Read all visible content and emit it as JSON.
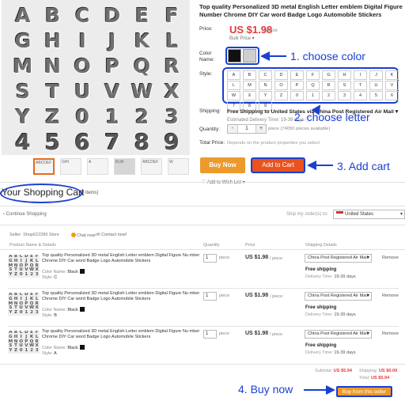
{
  "product": {
    "hero_rows": [
      [
        "A",
        "B",
        "C",
        "D",
        "E",
        "F"
      ],
      [
        "G",
        "H",
        "I",
        "J",
        "K",
        "L"
      ],
      [
        "M",
        "N",
        "O",
        "P",
        "Q",
        "R"
      ],
      [
        "S",
        "T",
        "U",
        "V",
        "W",
        "X"
      ],
      [
        "Y",
        "Z",
        "0",
        "1",
        "2",
        "3"
      ],
      [
        "4",
        "5",
        "6",
        "7",
        "8",
        "9"
      ]
    ],
    "thumbnails": [
      "ABCDEF",
      "GHI",
      "A",
      "KLM",
      "ABCDEF",
      "W"
    ],
    "title": "Top quality Personalized 3D metal English Letter emblem Digital Figure Number Chrome DIY Car word Badge Logo Automobile Stickers",
    "price_label": "Price:",
    "price": "US $1.98",
    "price_unit": "/ piece",
    "bulk_price": "Bulk Price ▾",
    "color_label": "Color Name:",
    "colors": [
      "#111111",
      "#cfcfcf"
    ],
    "style_label": "Style:",
    "styles": [
      "A",
      "B",
      "C",
      "D",
      "E",
      "F",
      "G",
      "H",
      "I",
      "J",
      "K",
      "L",
      "M",
      "N",
      "O",
      "P",
      "Q",
      "R",
      "S",
      "T",
      "U",
      "V",
      "W",
      "X",
      "Y",
      "Z",
      "0",
      "1",
      "2",
      "3",
      "4",
      "5",
      "6",
      "7",
      "8",
      "9"
    ],
    "shipping_label": "Shipping:",
    "shipping_text": "Free Shipping to United States via China Post Registered Air Mail ▾",
    "shipping_estimate": "Estimated Delivery Time: 19-39 days ⓘ",
    "quantity_label": "Quantity:",
    "quantity_value": "1",
    "quantity_minus": "-",
    "quantity_plus": "+",
    "quantity_note": "piece (74050 pieces available)",
    "total_price_label": "Total Price:",
    "total_price_text": "Depends on the product properties you select",
    "buy_now": "Buy Now",
    "add_to_cart": "Add to Cart",
    "wish": "Add to Wish List ▾",
    "wish_icon": "heart-icon"
  },
  "annotations": {
    "step1": "1. choose color",
    "step2": "2. choose letter",
    "step3": "3. Add cart",
    "step4": "4. Buy now"
  },
  "cart": {
    "title": "Your Shopping Cart",
    "count": "(3 items)",
    "continue": "‹ Continue Shopping",
    "ship_to_label": "Ship my order(s) to:",
    "country": "United States",
    "seller": "Seller:  Shop622289 Store",
    "chat": "Chat now!",
    "contact": "Contact now!",
    "headers": {
      "product": "Product Name & Details",
      "quantity": "Quantity",
      "price": "Price",
      "shipping": "Shipping Details"
    },
    "items": [
      {
        "title": "Top quality Personalized 3D metal English Letter emblem Digital Figure Nu mber Chrome DIY Car word Badge Logo Automobile Stickers",
        "color_label": "Color Name:",
        "color": "Black",
        "style_label": "Style:",
        "style": "C",
        "qty": "1",
        "unit": "piece",
        "price": "US $1.98",
        "per": "/ piece",
        "shipping_method": "China Post Registered Air Mail",
        "free_shipping": "Free shipping",
        "delivery_label": "Delivery Time:",
        "delivery": "19-39 days",
        "remove": "Remove"
      },
      {
        "title": "Top quality Personalized 3D metal English Letter emblem Digital Figure Nu mber Chrome DIY Car word Badge Logo Automobile Stickers",
        "color_label": "Color Name:",
        "color": "Black",
        "style_label": "Style:",
        "style": "B",
        "qty": "1",
        "unit": "piece",
        "price": "US $1.98",
        "per": "/ piece",
        "shipping_method": "China Post Registered Air Mail",
        "free_shipping": "Free shipping",
        "delivery_label": "Delivery Time:",
        "delivery": "19-39 days",
        "remove": "Remove"
      },
      {
        "title": "Top quality Personalized 3D metal English Letter emblem Digital Figure Nu mber Chrome DIY Car word Badge Logo Automobile Stickers",
        "color_label": "Color Name:",
        "color": "Black",
        "style_label": "Style:",
        "style": "A",
        "qty": "1",
        "unit": "piece",
        "price": "US $1.98",
        "per": "/ piece",
        "shipping_method": "China Post Registered Air Mail",
        "free_shipping": "Free shipping",
        "delivery_label": "Delivery Time:",
        "delivery": "19-39 days",
        "remove": "Remove"
      }
    ],
    "subtotal_label": "Subtotal:",
    "subtotal": "US $5.94",
    "shipping_label": "Shipping:",
    "shipping": "US $0.00",
    "total_label": "Total:",
    "total": "US $5.94",
    "buy_button": "Buy from this seller"
  },
  "colors": {
    "accent_blue": "#1a3fd1",
    "price_red": "#e4393c",
    "buy_orange": "#ec9a2c",
    "cart_orange": "#e8531f"
  }
}
